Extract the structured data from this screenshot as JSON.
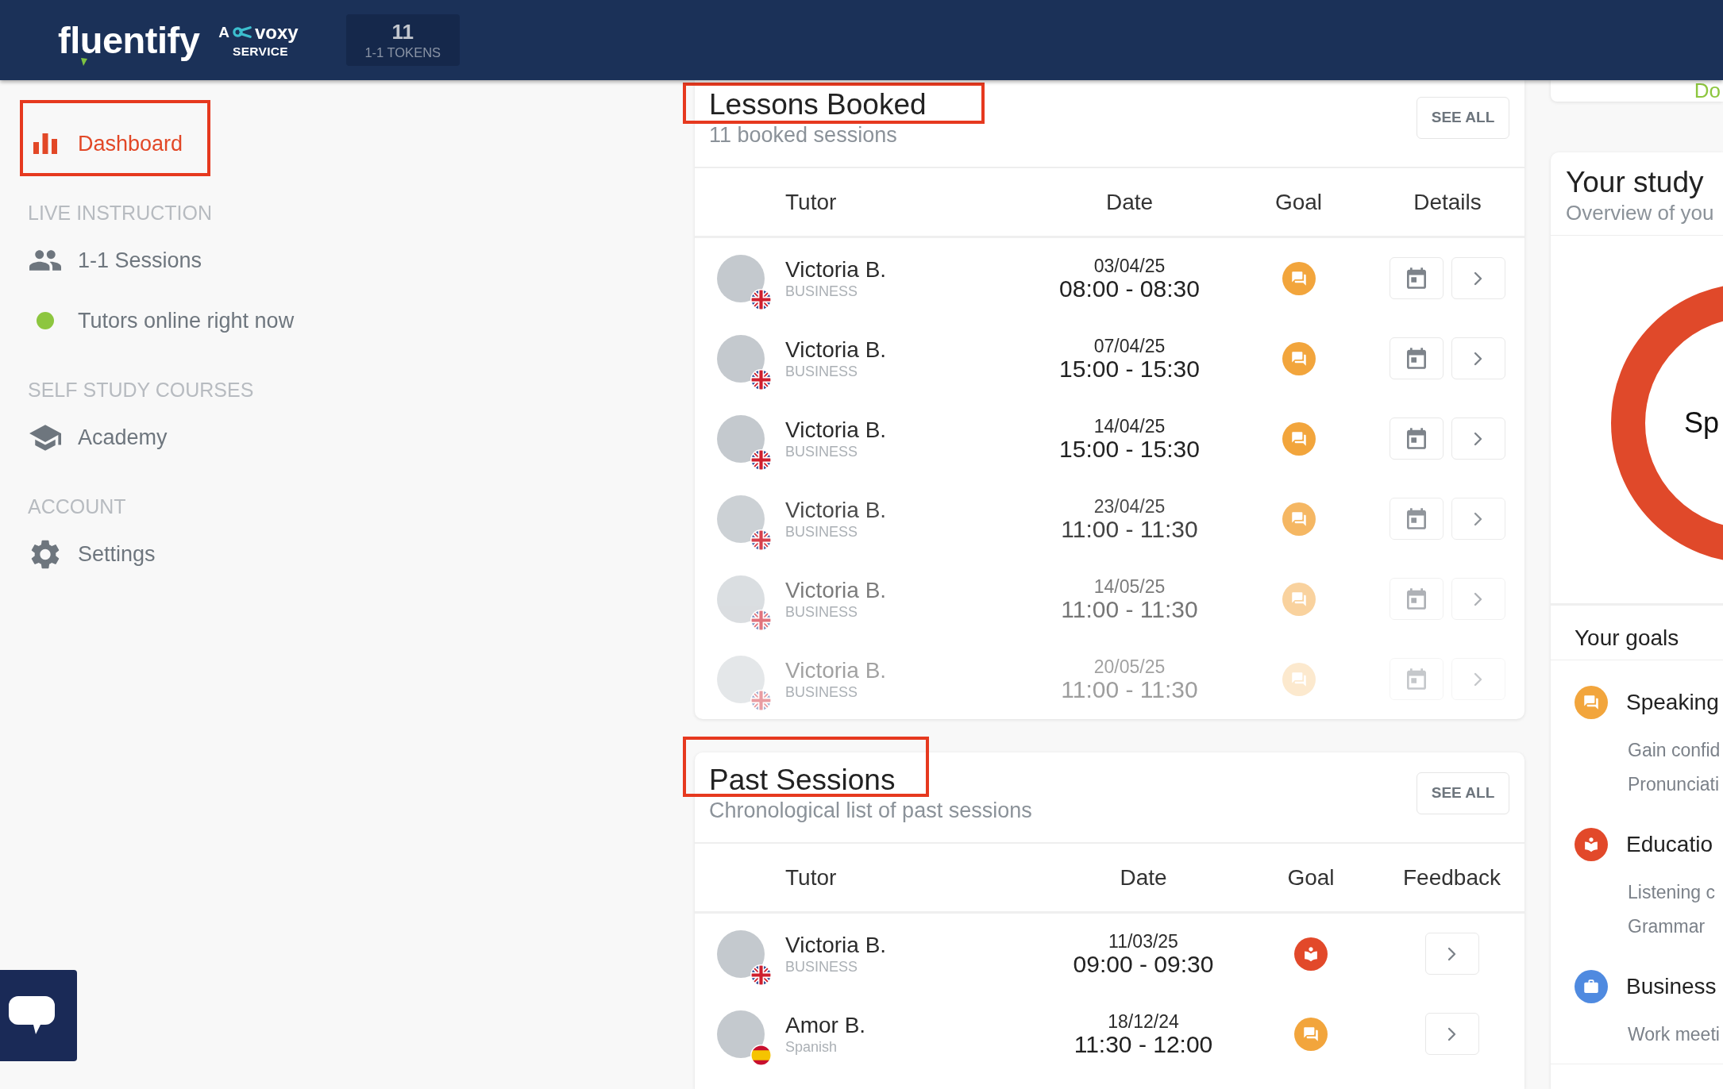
{
  "header": {
    "logo": "fluentify",
    "service": {
      "prefix": "A",
      "brand": "voxy",
      "suffix": "SERVICE"
    },
    "tokens": {
      "count": "11",
      "label": "1-1 TOKENS"
    }
  },
  "sidebar": {
    "sections": [
      {
        "items": [
          {
            "kind": "link",
            "label": "Dashboard",
            "selected": true,
            "highlighted": true
          }
        ]
      },
      {
        "heading": "LIVE INSTRUCTION",
        "items": [
          {
            "kind": "link",
            "label": "1-1 Sessions",
            "selected": false,
            "highlighted": false
          },
          {
            "kind": "status",
            "label": "Tutors online right now",
            "online": true
          }
        ]
      },
      {
        "heading": "SELF STUDY COURSES",
        "items": [
          {
            "kind": "link",
            "label": "Academy",
            "selected": false,
            "highlighted": false
          }
        ]
      },
      {
        "heading": "ACCOUNT",
        "items": [
          {
            "kind": "link",
            "label": "Settings",
            "selected": false,
            "highlighted": false
          }
        ]
      }
    ]
  },
  "cards": [
    {
      "kind": "upcoming",
      "title": "Lessons Booked",
      "highlighted": true,
      "subtitle": "11 booked sessions",
      "see_all": "SEE ALL",
      "columns": [
        "Tutor",
        "Date",
        "Goal",
        "Details"
      ],
      "rows": [
        {
          "tutor": "Victoria B.",
          "note": "BUSINESS",
          "flag": {
            "kind": "gb"
          },
          "date": "03/04/25",
          "time": "08:00 - 08:30",
          "goal": {
            "kind": "speaking",
            "color": "#f2a53c"
          }
        },
        {
          "tutor": "Victoria B.",
          "note": "BUSINESS",
          "flag": {
            "kind": "gb"
          },
          "date": "07/04/25",
          "time": "15:00 - 15:30",
          "goal": {
            "kind": "speaking",
            "color": "#f2a53c"
          }
        },
        {
          "tutor": "Victoria B.",
          "note": "BUSINESS",
          "flag": {
            "kind": "gb"
          },
          "date": "14/04/25",
          "time": "15:00 - 15:30",
          "goal": {
            "kind": "speaking",
            "color": "#f2a53c"
          }
        },
        {
          "tutor": "Victoria B.",
          "note": "BUSINESS",
          "flag": {
            "kind": "gb"
          },
          "date": "23/04/25",
          "time": "11:00 - 11:30",
          "goal": {
            "kind": "speaking",
            "color": "#f5b763"
          }
        },
        {
          "tutor": "Victoria B.",
          "note": "BUSINESS",
          "flag": {
            "kind": "gb"
          },
          "date": "14/05/25",
          "time": "11:00 - 11:30",
          "goal": {
            "kind": "speaking",
            "color": "#f9d29e"
          }
        },
        {
          "tutor": "Victoria B.",
          "note": "BUSINESS",
          "flag": {
            "kind": "gb"
          },
          "date": "20/05/25",
          "time": "11:00 - 11:30",
          "goal": {
            "kind": "speaking",
            "color": "#fce9ce"
          }
        }
      ]
    },
    {
      "kind": "past",
      "title": "Past Sessions",
      "highlighted": true,
      "subtitle": "Chronological list of past sessions",
      "see_all": "SEE ALL",
      "columns": [
        "Tutor",
        "Date",
        "Goal",
        "Feedback"
      ],
      "rows": [
        {
          "tutor": "Victoria B.",
          "note": "BUSINESS",
          "flag": {
            "kind": "gb"
          },
          "date": "11/03/25",
          "time": "09:00 - 09:30",
          "goal": {
            "kind": "education",
            "color": "#e2492a"
          }
        },
        {
          "tutor": "Amor B.",
          "note": "Spanish",
          "flag": {
            "kind": "es"
          },
          "date": "18/12/24",
          "time": "11:30 - 12:00",
          "goal": {
            "kind": "speaking",
            "color": "#f2a53c"
          }
        }
      ]
    }
  ],
  "right_panel": {
    "top_card": {
      "text": "Do"
    },
    "study_plan": {
      "title": "Your study",
      "subtitle": "Overview of you",
      "chart_label": "Sp"
    },
    "goals": {
      "title": "Your goals",
      "items": [
        {
          "kind": "speaking",
          "label": "Speaking",
          "color": "#f2a53c",
          "children": [
            {
              "label": "Gain confid"
            },
            {
              "label": "Pronunciati"
            }
          ]
        },
        {
          "kind": "education",
          "label": "Educatio",
          "color": "#e2492a",
          "children": [
            {
              "label": "Listening c"
            },
            {
              "label": "Grammar"
            }
          ]
        },
        {
          "kind": "business",
          "label": "Business",
          "color": "#4f8ae0",
          "children": [
            {
              "label": "Work meeti"
            }
          ]
        }
      ]
    }
  }
}
